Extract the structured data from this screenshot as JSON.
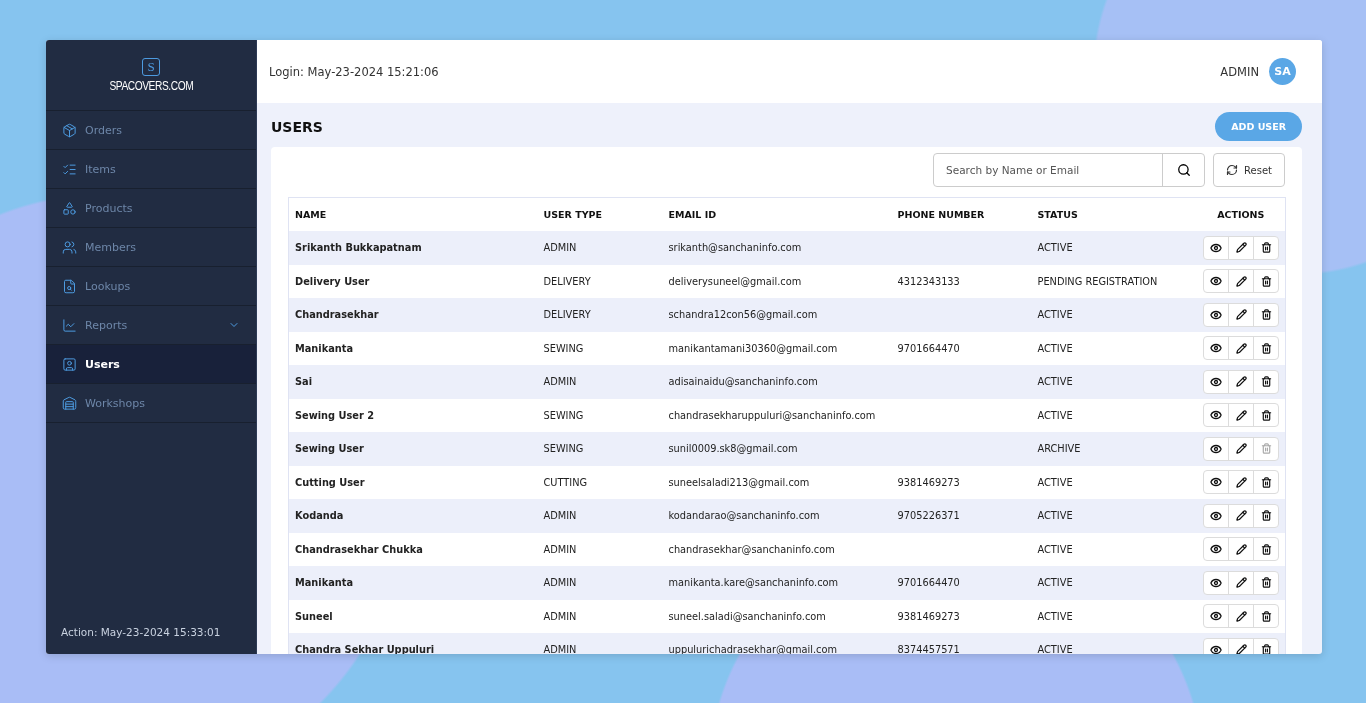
{
  "brand": {
    "mark": "S",
    "name": "SPACOVERS.COM"
  },
  "sidebar": {
    "items": [
      {
        "label": "Orders",
        "selected": false,
        "expandable": false
      },
      {
        "label": "Items",
        "selected": false,
        "expandable": false
      },
      {
        "label": "Products",
        "selected": false,
        "expandable": false
      },
      {
        "label": "Members",
        "selected": false,
        "expandable": false
      },
      {
        "label": "Lookups",
        "selected": false,
        "expandable": false
      },
      {
        "label": "Reports",
        "selected": false,
        "expandable": true
      },
      {
        "label": "Users",
        "selected": true,
        "expandable": false
      },
      {
        "label": "Workshops",
        "selected": false,
        "expandable": false
      }
    ],
    "footer": "Action: May-23-2024 15:33:01"
  },
  "header": {
    "login": "Login: May-23-2024 15:21:06",
    "user": "ADMIN",
    "avatar": "SA"
  },
  "page": {
    "title": "USERS",
    "add_button": "ADD USER"
  },
  "search": {
    "placeholder": "Search by Name or Email",
    "reset": "Reset"
  },
  "table": {
    "columns": [
      "NAME",
      "USER TYPE",
      "EMAIL ID",
      "PHONE NUMBER",
      "STATUS",
      "ACTIONS"
    ],
    "rows": [
      {
        "name": "Srikanth Bukkapatnam",
        "type": "ADMIN",
        "email": "srikanth@sanchaninfo.com",
        "phone": "",
        "status": "ACTIVE",
        "delete_disabled": false
      },
      {
        "name": "Delivery User",
        "type": "DELIVERY",
        "email": "deliverysuneel@gmail.com",
        "phone": "4312343133",
        "status": "PENDING REGISTRATION",
        "delete_disabled": false
      },
      {
        "name": "Chandrasekhar",
        "type": "DELIVERY",
        "email": "schandra12con56@gmail.com",
        "phone": "",
        "status": "ACTIVE",
        "delete_disabled": false
      },
      {
        "name": "Manikanta",
        "type": "SEWING",
        "email": "manikantamani30360@gmail.com",
        "phone": "9701664470",
        "status": "ACTIVE",
        "delete_disabled": false
      },
      {
        "name": "Sai",
        "type": "ADMIN",
        "email": "adisainaidu@sanchaninfo.com",
        "phone": "",
        "status": "ACTIVE",
        "delete_disabled": false
      },
      {
        "name": "Sewing User 2",
        "type": "SEWING",
        "email": "chandrasekharuppuluri@sanchaninfo.com",
        "phone": "",
        "status": "ACTIVE",
        "delete_disabled": false
      },
      {
        "name": "Sewing User",
        "type": "SEWING",
        "email": "sunil0009.sk8@gmail.com",
        "phone": "",
        "status": "ARCHIVE",
        "delete_disabled": true
      },
      {
        "name": "Cutting User",
        "type": "CUTTING",
        "email": "suneelsaladi213@gmail.com",
        "phone": "9381469273",
        "status": "ACTIVE",
        "delete_disabled": false
      },
      {
        "name": "Kodanda",
        "type": "ADMIN",
        "email": "kodandarao@sanchaninfo.com",
        "phone": "9705226371",
        "status": "ACTIVE",
        "delete_disabled": false
      },
      {
        "name": "Chandrasekhar Chukka",
        "type": "ADMIN",
        "email": "chandrasekhar@sanchaninfo.com",
        "phone": "",
        "status": "ACTIVE",
        "delete_disabled": false
      },
      {
        "name": "Manikanta",
        "type": "ADMIN",
        "email": "manikanta.kare@sanchaninfo.com",
        "phone": "9701664470",
        "status": "ACTIVE",
        "delete_disabled": false
      },
      {
        "name": "Suneel",
        "type": "ADMIN",
        "email": "suneel.saladi@sanchaninfo.com",
        "phone": "9381469273",
        "status": "ACTIVE",
        "delete_disabled": false
      },
      {
        "name": "Chandra Sekhar Uppuluri",
        "type": "ADMIN",
        "email": "uppulurichadrasekhar@gmail.com",
        "phone": "8374457571",
        "status": "ACTIVE",
        "delete_disabled": false
      }
    ]
  }
}
